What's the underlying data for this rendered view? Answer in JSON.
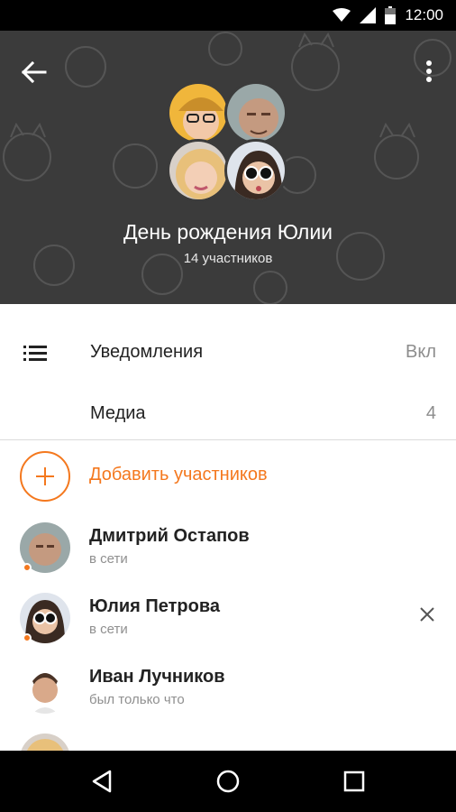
{
  "status_bar": {
    "time": "12:00",
    "icons": [
      "wifi-icon",
      "signal-icon",
      "battery-icon"
    ]
  },
  "header": {
    "title": "День рождения Юлии",
    "subtitle": "14 участников",
    "back_icon": "arrow-back-icon",
    "more_icon": "more-vert-icon",
    "avatars": [
      "photo-woman-glasses",
      "photo-man",
      "photo-woman-blonde",
      "photo-woman-sunglasses"
    ]
  },
  "settings": [
    {
      "label": "Уведомления",
      "value": "Вкл"
    },
    {
      "label": "Медиа",
      "value": "4"
    }
  ],
  "add_members": {
    "label": "Добавить участников"
  },
  "members": [
    {
      "name": "Дмитрий Остапов",
      "status": "в сети"
    },
    {
      "name": "Юлия Петрова",
      "status": "в сети"
    },
    {
      "name": "Иван Лучников",
      "status": "был только что"
    }
  ],
  "colors": {
    "accent": "#f4781e",
    "header_bg": "#3b3b3b",
    "text_primary": "#222222",
    "text_secondary": "#8f8f8f"
  },
  "nav_bar": [
    "back-triangle-icon",
    "home-circle-icon",
    "recents-square-icon"
  ]
}
